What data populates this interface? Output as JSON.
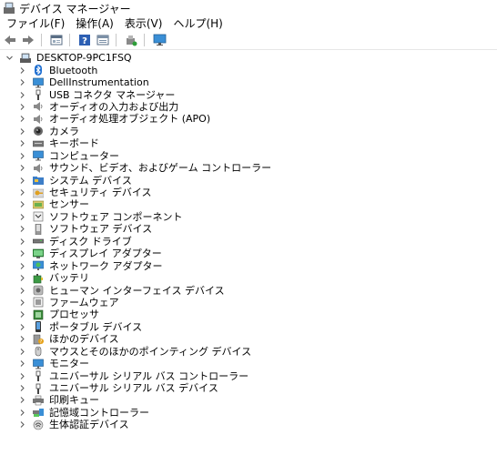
{
  "window": {
    "title": "デバイス マネージャー"
  },
  "menu": [
    "ファイル(F)",
    "操作(A)",
    "表示(V)",
    "ヘルプ(H)"
  ],
  "toolbar": {
    "buttons": [
      "back-icon",
      "forward-icon",
      "properties-icon",
      "help-icon",
      "view-icon",
      "scan-hardware-icon",
      "monitor-icon"
    ]
  },
  "tree": {
    "root": {
      "label": "DESKTOP-9PC1FSQ",
      "icon": "computer-root-icon"
    },
    "items": [
      {
        "label": "Bluetooth",
        "icon": "bluetooth-icon"
      },
      {
        "label": "DellInstrumentation",
        "icon": "monitor-icon"
      },
      {
        "label": "USB コネクタ マネージャー",
        "icon": "usb-icon"
      },
      {
        "label": "オーディオの入力および出力",
        "icon": "speaker-icon"
      },
      {
        "label": "オーディオ処理オブジェクト (APO)",
        "icon": "speaker-icon"
      },
      {
        "label": "カメラ",
        "icon": "camera-icon"
      },
      {
        "label": "キーボード",
        "icon": "keyboard-icon"
      },
      {
        "label": "コンピューター",
        "icon": "monitor-icon"
      },
      {
        "label": "サウンド、ビデオ、およびゲーム コントローラー",
        "icon": "speaker-icon"
      },
      {
        "label": "システム デバイス",
        "icon": "folder-icon"
      },
      {
        "label": "セキュリティ デバイス",
        "icon": "key-icon"
      },
      {
        "label": "センサー",
        "icon": "sensor-icon"
      },
      {
        "label": "ソフトウェア コンポーネント",
        "icon": "component-icon"
      },
      {
        "label": "ソフトウェア デバイス",
        "icon": "device-icon"
      },
      {
        "label": "ディスク ドライブ",
        "icon": "disk-icon"
      },
      {
        "label": "ディスプレイ アダプター",
        "icon": "display-icon"
      },
      {
        "label": "ネットワーク アダプター",
        "icon": "network-icon"
      },
      {
        "label": "バッテリ",
        "icon": "battery-icon"
      },
      {
        "label": "ヒューマン インターフェイス デバイス",
        "icon": "hid-icon"
      },
      {
        "label": "ファームウェア",
        "icon": "firmware-icon"
      },
      {
        "label": "プロセッサ",
        "icon": "processor-icon"
      },
      {
        "label": "ポータブル デバイス",
        "icon": "portable-icon"
      },
      {
        "label": "ほかのデバイス",
        "icon": "unknown-device-icon"
      },
      {
        "label": "マウスとそのほかのポインティング デバイス",
        "icon": "mouse-icon"
      },
      {
        "label": "モニター",
        "icon": "monitor-icon"
      },
      {
        "label": "ユニバーサル シリアル バス コントローラー",
        "icon": "usb-icon"
      },
      {
        "label": "ユニバーサル シリアル バス デバイス",
        "icon": "usb-icon"
      },
      {
        "label": "印刷キュー",
        "icon": "printer-icon"
      },
      {
        "label": "記憶域コントローラー",
        "icon": "storage-icon"
      },
      {
        "label": "生体認証デバイス",
        "icon": "biometric-icon"
      }
    ]
  }
}
